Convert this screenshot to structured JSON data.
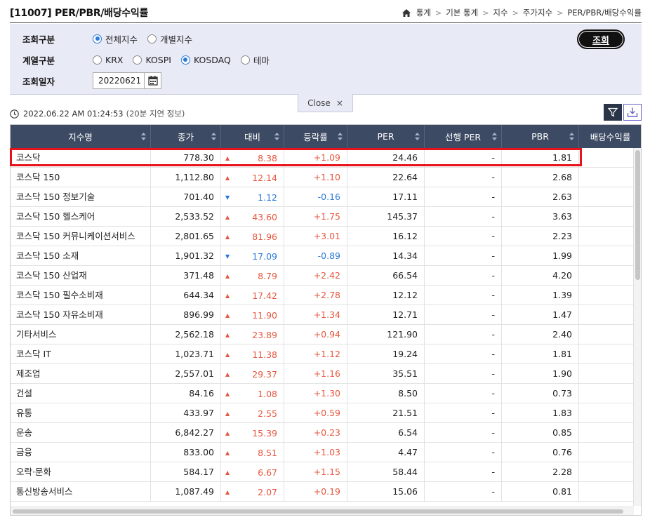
{
  "header": {
    "title": "[11007] PER/PBR/배당수익률",
    "breadcrumb": [
      "통계",
      "기본 통계",
      "지수",
      "주가지수",
      "PER/PBR/배당수익률"
    ]
  },
  "search": {
    "type_label": "조회구분",
    "type_options": [
      {
        "label": "전체지수",
        "selected": true
      },
      {
        "label": "개별지수",
        "selected": false
      }
    ],
    "series_label": "계열구분",
    "series_options": [
      {
        "label": "KRX",
        "selected": false
      },
      {
        "label": "KOSPI",
        "selected": false
      },
      {
        "label": "KOSDAQ",
        "selected": true
      },
      {
        "label": "테마",
        "selected": false
      }
    ],
    "date_label": "조회일자",
    "date_value": "20220621",
    "query_button": "조회"
  },
  "close_tab": {
    "label": "Close",
    "icon": "×"
  },
  "status": {
    "timestamp": "2022.06.22 AM 01:24:53",
    "note": "(20분 지연 정보)"
  },
  "colors": {
    "header_bg": "#3c4a63",
    "panel_bg": "#e8eaf6",
    "up": "#e6573f",
    "down": "#2a7ad8",
    "highlight": "#e8121c"
  },
  "table": {
    "columns": [
      "지수명",
      "종가",
      "대비",
      "등락률",
      "PER",
      "선행 PER",
      "PBR",
      "배당수익률"
    ],
    "rows": [
      {
        "name": "코스닥",
        "close": "778.30",
        "dir": "up",
        "change": "8.38",
        "rate": "+1.09",
        "per": "24.46",
        "fper": "-",
        "pbr": "1.81"
      },
      {
        "name": "코스닥 150",
        "close": "1,112.80",
        "dir": "up",
        "change": "12.14",
        "rate": "+1.10",
        "per": "22.64",
        "fper": "-",
        "pbr": "2.68"
      },
      {
        "name": "코스닥 150 정보기술",
        "close": "701.40",
        "dir": "down",
        "change": "1.12",
        "rate": "-0.16",
        "per": "17.11",
        "fper": "-",
        "pbr": "2.63"
      },
      {
        "name": "코스닥 150 헬스케어",
        "close": "2,533.52",
        "dir": "up",
        "change": "43.60",
        "rate": "+1.75",
        "per": "145.37",
        "fper": "-",
        "pbr": "3.63"
      },
      {
        "name": "코스닥 150 커뮤니케이션서비스",
        "close": "2,801.65",
        "dir": "up",
        "change": "81.96",
        "rate": "+3.01",
        "per": "16.12",
        "fper": "-",
        "pbr": "2.23"
      },
      {
        "name": "코스닥 150 소재",
        "close": "1,901.32",
        "dir": "down",
        "change": "17.09",
        "rate": "-0.89",
        "per": "14.34",
        "fper": "-",
        "pbr": "1.99"
      },
      {
        "name": "코스닥 150 산업재",
        "close": "371.48",
        "dir": "up",
        "change": "8.79",
        "rate": "+2.42",
        "per": "66.54",
        "fper": "-",
        "pbr": "4.20"
      },
      {
        "name": "코스닥 150 필수소비재",
        "close": "644.34",
        "dir": "up",
        "change": "17.42",
        "rate": "+2.78",
        "per": "12.12",
        "fper": "-",
        "pbr": "1.39"
      },
      {
        "name": "코스닥 150 자유소비재",
        "close": "896.99",
        "dir": "up",
        "change": "11.90",
        "rate": "+1.34",
        "per": "12.71",
        "fper": "-",
        "pbr": "1.47"
      },
      {
        "name": "기타서비스",
        "close": "2,562.18",
        "dir": "up",
        "change": "23.89",
        "rate": "+0.94",
        "per": "121.90",
        "fper": "-",
        "pbr": "2.40"
      },
      {
        "name": "코스닥 IT",
        "close": "1,023.71",
        "dir": "up",
        "change": "11.38",
        "rate": "+1.12",
        "per": "19.24",
        "fper": "-",
        "pbr": "1.81"
      },
      {
        "name": "제조업",
        "close": "2,557.01",
        "dir": "up",
        "change": "29.37",
        "rate": "+1.16",
        "per": "35.51",
        "fper": "-",
        "pbr": "1.90"
      },
      {
        "name": "건설",
        "close": "84.16",
        "dir": "up",
        "change": "1.08",
        "rate": "+1.30",
        "per": "8.50",
        "fper": "-",
        "pbr": "0.73"
      },
      {
        "name": "유통",
        "close": "433.97",
        "dir": "up",
        "change": "2.55",
        "rate": "+0.59",
        "per": "21.51",
        "fper": "-",
        "pbr": "1.83"
      },
      {
        "name": "운송",
        "close": "6,842.27",
        "dir": "up",
        "change": "15.39",
        "rate": "+0.23",
        "per": "6.54",
        "fper": "-",
        "pbr": "0.85"
      },
      {
        "name": "금융",
        "close": "833.00",
        "dir": "up",
        "change": "8.51",
        "rate": "+1.03",
        "per": "4.47",
        "fper": "-",
        "pbr": "0.76"
      },
      {
        "name": "오락·문화",
        "close": "584.17",
        "dir": "up",
        "change": "6.67",
        "rate": "+1.15",
        "per": "58.44",
        "fper": "-",
        "pbr": "2.28"
      },
      {
        "name": "통신방송서비스",
        "close": "1,087.49",
        "dir": "up",
        "change": "2.07",
        "rate": "+0.19",
        "per": "15.06",
        "fper": "-",
        "pbr": "0.81"
      }
    ]
  }
}
